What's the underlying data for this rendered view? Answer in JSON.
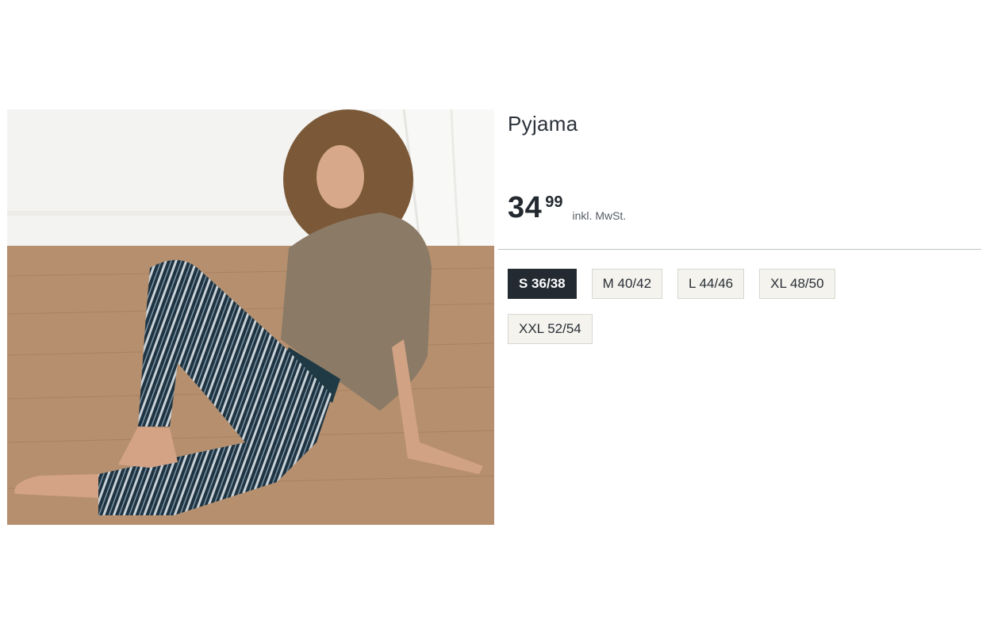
{
  "product": {
    "title": "Pyjama",
    "price_main": "34",
    "price_cents": "99",
    "price_note": "inkl. MwSt.",
    "image_alt": "Model in brown top and striped pyjama trousers sitting on wooden floor"
  },
  "sizes": [
    {
      "label": "S 36/38",
      "selected": true
    },
    {
      "label": "M 40/42",
      "selected": false
    },
    {
      "label": "L 44/46",
      "selected": false
    },
    {
      "label": "XL 48/50",
      "selected": false
    },
    {
      "label": "XXL 52/54",
      "selected": false
    }
  ],
  "colors": {
    "selected_bg": "#232a31",
    "size_bg": "#f4f3ee",
    "divider": "#bfc3c7"
  }
}
